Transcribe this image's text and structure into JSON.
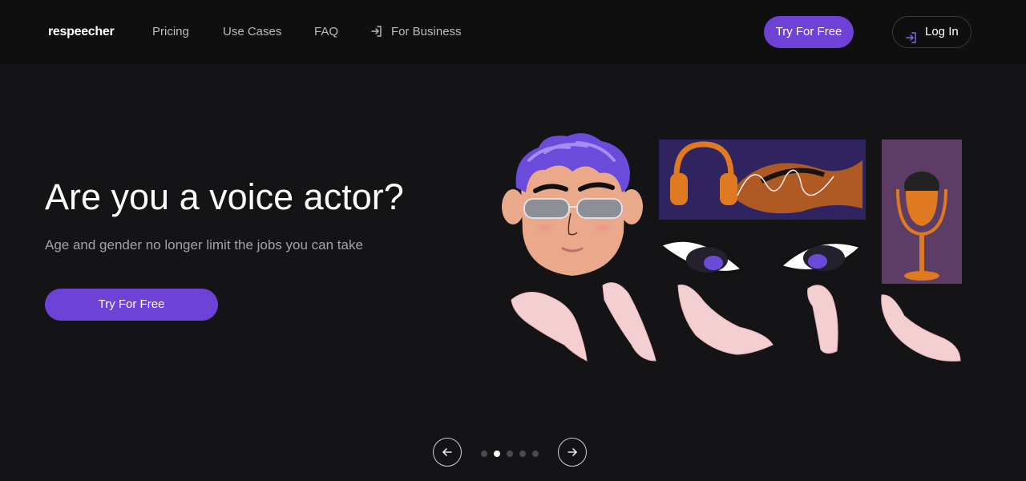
{
  "header": {
    "logo": "respeecher",
    "nav": [
      {
        "label": "Pricing",
        "icon": ""
      },
      {
        "label": "Use Cases",
        "icon": ""
      },
      {
        "label": "FAQ",
        "icon": ""
      },
      {
        "label": "For Business",
        "icon": "login-arrow-icon"
      }
    ],
    "try_label": "Try For Free",
    "login_label": "Log In",
    "login_icon": "login-arrow-icon"
  },
  "hero": {
    "title": "Are you a voice actor?",
    "subtitle": "Age and gender no longer limit the jobs you can take",
    "cta_label": "Try For Free"
  },
  "carousel": {
    "slides": 5,
    "active_slide": 2,
    "prev_icon": "arrow-left-icon",
    "next_icon": "arrow-right-icon"
  },
  "colors": {
    "accent": "#6e42d6",
    "background": "#141416",
    "header_bg": "#0f0f10",
    "muted_text": "#a2a2aa"
  }
}
